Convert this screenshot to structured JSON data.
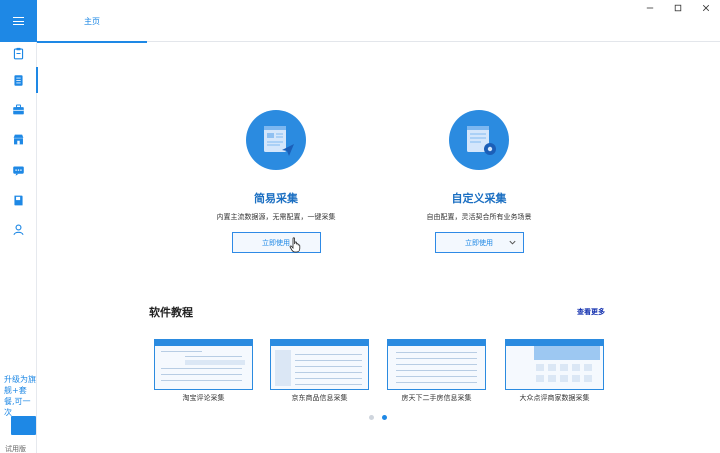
{
  "titlebar": {
    "home_tab": "主页"
  },
  "sidebar": {
    "upgrade_text": "升级为旗舰+套餐,可一次",
    "bottom_label": "试用版",
    "items": [
      {
        "icon": "clipboard-icon"
      },
      {
        "icon": "document-icon",
        "active": true
      },
      {
        "icon": "toolbox-icon"
      },
      {
        "icon": "store-icon"
      },
      {
        "icon": "chat-icon"
      },
      {
        "icon": "book-icon"
      },
      {
        "icon": "user-icon"
      }
    ]
  },
  "features": [
    {
      "title": "简易采集",
      "description": "内置主流数据源，无需配置，一键采集",
      "button_label": "立即使用"
    },
    {
      "title": "自定义采集",
      "description": "自由配置，灵活契合所有业务场景",
      "button_label": "立即使用"
    }
  ],
  "tutorials": {
    "heading": "软件教程",
    "see_more": "查看更多",
    "items": [
      {
        "label": "淘宝评论采集"
      },
      {
        "label": "京东商品信息采集"
      },
      {
        "label": "房天下二手房信息采集"
      },
      {
        "label": "大众点评商家数据采集"
      }
    ],
    "pagination": {
      "pages": 2,
      "current": 2
    }
  },
  "colors": {
    "accent": "#1e88e5",
    "title_blue": "#1b6fc2",
    "link": "#1633b0"
  }
}
